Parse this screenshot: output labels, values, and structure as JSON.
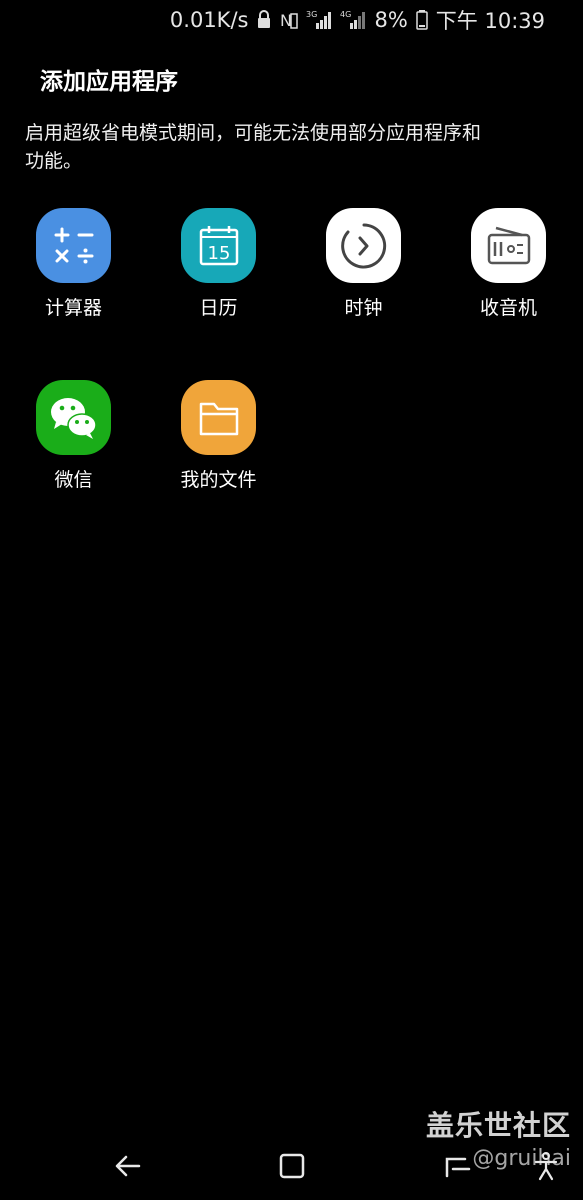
{
  "status_bar": {
    "speed": "0.01K/s",
    "net1": "3G",
    "net2": "4G",
    "battery": "8%",
    "time": "下午 10:39"
  },
  "header": {
    "title": "添加应用程序"
  },
  "description": "启用超级省电模式期间，可能无法使用部分应用程序和功能。",
  "apps": [
    {
      "label": "计算器",
      "icon": "calculator-icon",
      "color": "#4a90e2"
    },
    {
      "label": "日历",
      "icon": "calendar-icon",
      "color": "#17a8b8",
      "day": "15"
    },
    {
      "label": "时钟",
      "icon": "clock-icon",
      "color": "#ffffff"
    },
    {
      "label": "收音机",
      "icon": "radio-icon",
      "color": "#ffffff"
    },
    {
      "label": "微信",
      "icon": "wechat-icon",
      "color": "#1aad19"
    },
    {
      "label": "我的文件",
      "icon": "folder-icon",
      "color": "#f0a53a"
    }
  ],
  "watermark": {
    "title": "盖乐世社区",
    "sub": "@gruihai"
  }
}
